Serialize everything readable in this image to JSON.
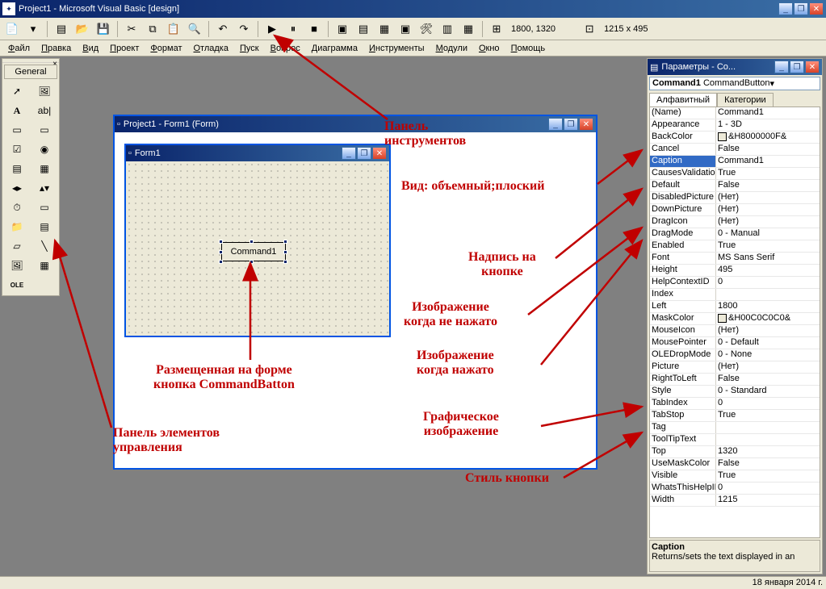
{
  "titlebar": {
    "title": "Project1 - Microsoft Visual Basic [design]"
  },
  "toolbar": {
    "coords": "1800, 1320",
    "size": "1215 x 495"
  },
  "menu": [
    "Файл",
    "Правка",
    "Вид",
    "Проект",
    "Формат",
    "Отладка",
    "Пуск",
    "Вопрос",
    "Диаграмма",
    "Инструменты",
    "Модули",
    "Окно",
    "Помощь"
  ],
  "toolbox": {
    "header": "General"
  },
  "designer": {
    "container_title": "Project1 - Form1 (Form)",
    "form_title": "Form1",
    "button_caption": "Command1"
  },
  "props": {
    "window_title": "Параметры - Co...",
    "obj_name": "Command1",
    "obj_type": "CommandButton",
    "tabs": {
      "alpha": "Алфавитный",
      "cat": "Категории"
    },
    "rows": [
      {
        "n": "(Name)",
        "v": "Command1"
      },
      {
        "n": "Appearance",
        "v": "1 - 3D"
      },
      {
        "n": "BackColor",
        "v": "&H8000000F&",
        "swatch": true
      },
      {
        "n": "Cancel",
        "v": "False"
      },
      {
        "n": "Caption",
        "v": "Command1",
        "sel": true
      },
      {
        "n": "CausesValidation",
        "v": "True"
      },
      {
        "n": "Default",
        "v": "False"
      },
      {
        "n": "DisabledPicture",
        "v": "(Нет)"
      },
      {
        "n": "DownPicture",
        "v": "(Нет)"
      },
      {
        "n": "DragIcon",
        "v": "(Нет)"
      },
      {
        "n": "DragMode",
        "v": "0 - Manual"
      },
      {
        "n": "Enabled",
        "v": "True"
      },
      {
        "n": "Font",
        "v": "MS Sans Serif"
      },
      {
        "n": "Height",
        "v": "495"
      },
      {
        "n": "HelpContextID",
        "v": "0"
      },
      {
        "n": "Index",
        "v": ""
      },
      {
        "n": "Left",
        "v": "1800"
      },
      {
        "n": "MaskColor",
        "v": "&H00C0C0C0&",
        "swatch": true
      },
      {
        "n": "MouseIcon",
        "v": "(Нет)"
      },
      {
        "n": "MousePointer",
        "v": "0 - Default"
      },
      {
        "n": "OLEDropMode",
        "v": "0 - None"
      },
      {
        "n": "Picture",
        "v": "(Нет)"
      },
      {
        "n": "RightToLeft",
        "v": "False"
      },
      {
        "n": "Style",
        "v": "0 - Standard"
      },
      {
        "n": "TabIndex",
        "v": "0"
      },
      {
        "n": "TabStop",
        "v": "True"
      },
      {
        "n": "Tag",
        "v": ""
      },
      {
        "n": "ToolTipText",
        "v": ""
      },
      {
        "n": "Top",
        "v": "1320"
      },
      {
        "n": "UseMaskColor",
        "v": "False"
      },
      {
        "n": "Visible",
        "v": "True"
      },
      {
        "n": "WhatsThisHelpID",
        "v": "0"
      },
      {
        "n": "Width",
        "v": "1215"
      }
    ],
    "desc_title": "Caption",
    "desc_text": "Returns/sets the text displayed in an"
  },
  "annotations": {
    "a1": "Панель\nинструментов",
    "a2": "Вид: объемный;плоский",
    "a3": "Надпись на\nкнопке",
    "a4": "Изображение\nкогда не нажато",
    "a5": "Изображение\nкогда нажато",
    "a6": "Графическое\nизображение",
    "a7": "Стиль кнопки",
    "a8": "Размещенная на форме\nкнопка CommandBatton",
    "a9": "Панель элементов\nуправления"
  },
  "statusbar": {
    "date": "18 января 2014 г."
  }
}
